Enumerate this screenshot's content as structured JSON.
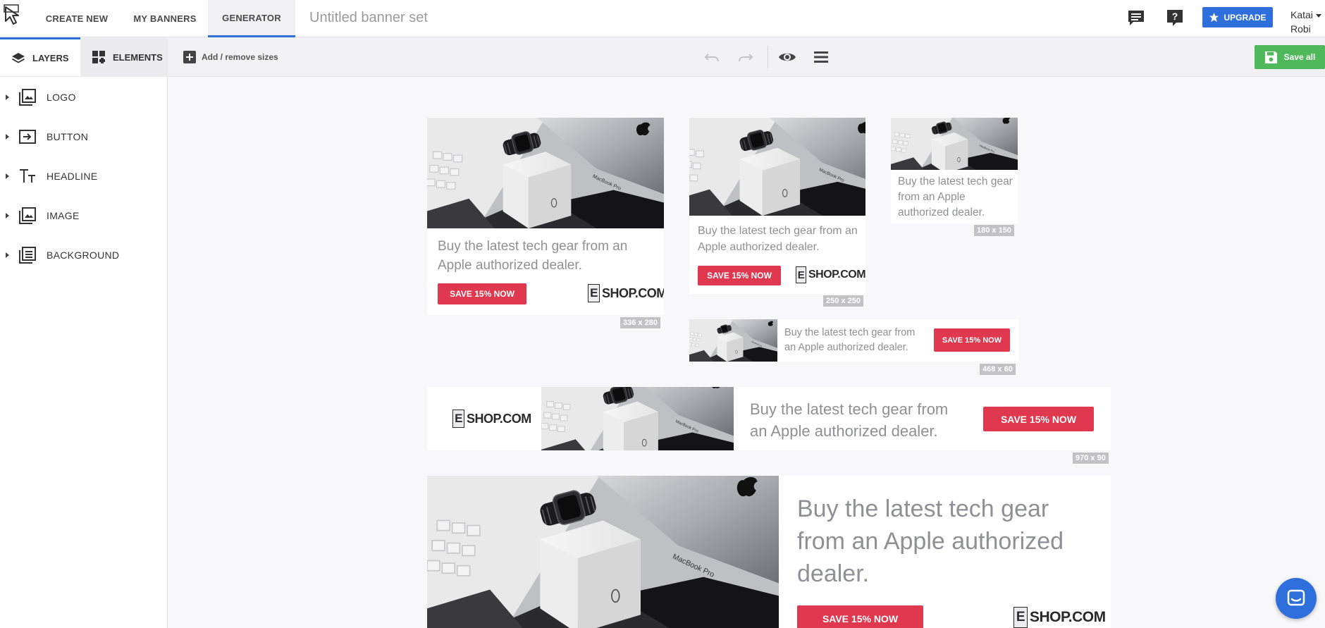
{
  "app": {
    "nav": {
      "create_new": "CREATE NEW",
      "my_banners": "MY BANNERS",
      "generator": "GENERATOR"
    },
    "doc_title": "Untitled banner set",
    "upgrade_label": "UPGRADE",
    "user": {
      "first": "Katai",
      "last": "Robi"
    }
  },
  "sidebar": {
    "tabs": {
      "layers": "LAYERS",
      "elements": "ELEMENTS"
    },
    "layers": [
      {
        "label": "LOGO",
        "icon": "image-stack-icon"
      },
      {
        "label": "BUTTON",
        "icon": "button-enter-icon"
      },
      {
        "label": "HEADLINE",
        "icon": "text-tt-icon"
      },
      {
        "label": "IMAGE",
        "icon": "image-stack-icon"
      },
      {
        "label": "BACKGROUND",
        "icon": "background-list-icon"
      }
    ]
  },
  "toolbar": {
    "add_sizes": "Add / remove sizes",
    "save_all": "Save all"
  },
  "banner_content": {
    "headline": "Buy the latest tech gear from an Apple authorized dealer.",
    "cta": "SAVE 15% NOW",
    "brand_letter": "E",
    "brand_rest": "SHOP.COM"
  },
  "banners": {
    "b336": {
      "size": "336 x 280"
    },
    "b250": {
      "size": "250 x 250"
    },
    "b180": {
      "size": "180 x 150"
    },
    "b468": {
      "size": "468 x 60"
    },
    "b970": {
      "size": "970 x 90"
    }
  },
  "colors": {
    "accent": "#2f6fdc",
    "cta": "#e0384e",
    "save": "#4fb85a",
    "headline": "#8f8f96"
  }
}
